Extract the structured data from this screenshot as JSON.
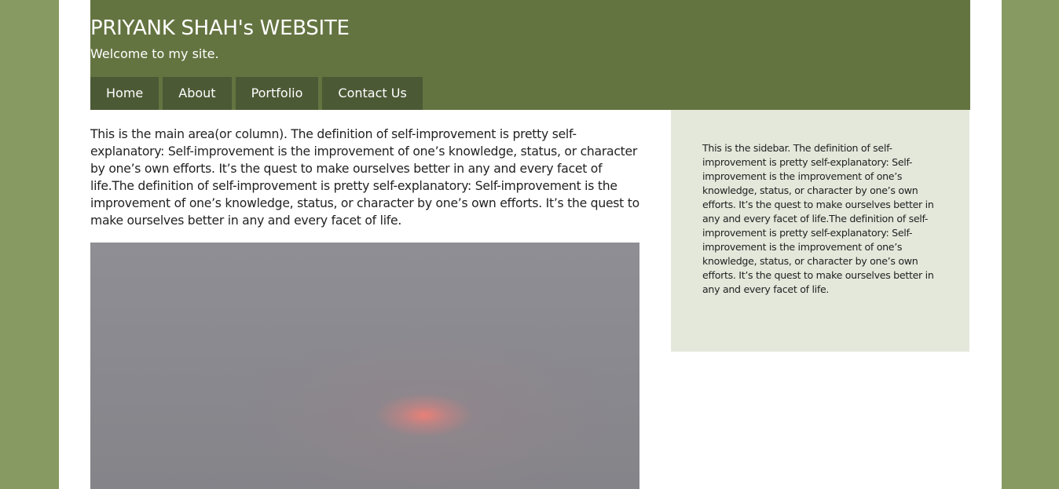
{
  "header": {
    "title": "PRIYANK SHAH's WEBSITE",
    "tagline": "Welcome to my site."
  },
  "nav": {
    "items": [
      {
        "label": "Home"
      },
      {
        "label": "About"
      },
      {
        "label": "Portfolio"
      },
      {
        "label": "Contact Us"
      }
    ]
  },
  "main": {
    "text": "This is the main area(or column). The definition of self-improvement is pretty self-explanatory: Self-improvement is the improvement of one’s knowledge, status, or character by one’s own efforts. It’s the quest to make ourselves better in any and every facet of life.The definition of self-improvement is pretty self-explanatory: Self-improvement is the improvement of one’s knowledge, status, or character by one’s own efforts. It’s the quest to make ourselves better in any and every facet of life."
  },
  "sidebar": {
    "text": "This is the sidebar. The definition of self-improvement is pretty self-explanatory: Self-improvement is the improvement of one’s knowledge, status, or character by one’s own efforts. It’s the quest to make ourselves better in any and every facet of life.The definition of self-improvement is pretty self-explanatory: Self-improvement is the improvement of one’s knowledge, status, or character by one’s own efforts. It’s the quest to make ourselves better in any and every facet of life."
  },
  "colors": {
    "background": "#869a61",
    "header": "#647441",
    "nav_item": "#4c5935",
    "sidebar": "#e4e8db"
  }
}
